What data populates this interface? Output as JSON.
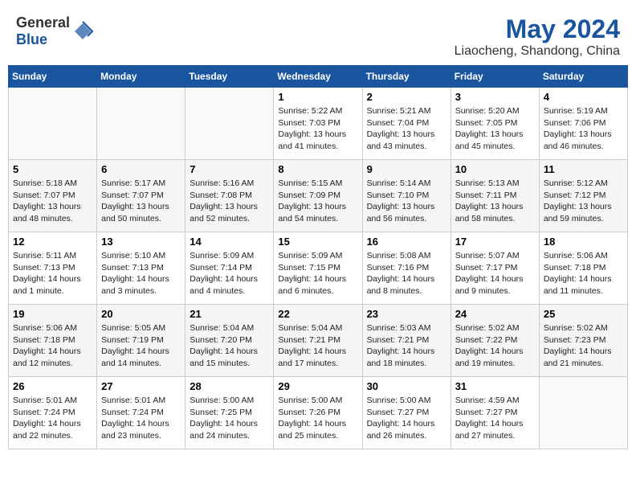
{
  "header": {
    "logo_general": "General",
    "logo_blue": "Blue",
    "month_year": "May 2024",
    "location": "Liaocheng, Shandong, China"
  },
  "weekdays": [
    "Sunday",
    "Monday",
    "Tuesday",
    "Wednesday",
    "Thursday",
    "Friday",
    "Saturday"
  ],
  "weeks": [
    [
      {
        "day": "",
        "info": ""
      },
      {
        "day": "",
        "info": ""
      },
      {
        "day": "",
        "info": ""
      },
      {
        "day": "1",
        "info": "Sunrise: 5:22 AM\nSunset: 7:03 PM\nDaylight: 13 hours\nand 41 minutes."
      },
      {
        "day": "2",
        "info": "Sunrise: 5:21 AM\nSunset: 7:04 PM\nDaylight: 13 hours\nand 43 minutes."
      },
      {
        "day": "3",
        "info": "Sunrise: 5:20 AM\nSunset: 7:05 PM\nDaylight: 13 hours\nand 45 minutes."
      },
      {
        "day": "4",
        "info": "Sunrise: 5:19 AM\nSunset: 7:06 PM\nDaylight: 13 hours\nand 46 minutes."
      }
    ],
    [
      {
        "day": "5",
        "info": "Sunrise: 5:18 AM\nSunset: 7:07 PM\nDaylight: 13 hours\nand 48 minutes."
      },
      {
        "day": "6",
        "info": "Sunrise: 5:17 AM\nSunset: 7:07 PM\nDaylight: 13 hours\nand 50 minutes."
      },
      {
        "day": "7",
        "info": "Sunrise: 5:16 AM\nSunset: 7:08 PM\nDaylight: 13 hours\nand 52 minutes."
      },
      {
        "day": "8",
        "info": "Sunrise: 5:15 AM\nSunset: 7:09 PM\nDaylight: 13 hours\nand 54 minutes."
      },
      {
        "day": "9",
        "info": "Sunrise: 5:14 AM\nSunset: 7:10 PM\nDaylight: 13 hours\nand 56 minutes."
      },
      {
        "day": "10",
        "info": "Sunrise: 5:13 AM\nSunset: 7:11 PM\nDaylight: 13 hours\nand 58 minutes."
      },
      {
        "day": "11",
        "info": "Sunrise: 5:12 AM\nSunset: 7:12 PM\nDaylight: 13 hours\nand 59 minutes."
      }
    ],
    [
      {
        "day": "12",
        "info": "Sunrise: 5:11 AM\nSunset: 7:13 PM\nDaylight: 14 hours\nand 1 minute."
      },
      {
        "day": "13",
        "info": "Sunrise: 5:10 AM\nSunset: 7:13 PM\nDaylight: 14 hours\nand 3 minutes."
      },
      {
        "day": "14",
        "info": "Sunrise: 5:09 AM\nSunset: 7:14 PM\nDaylight: 14 hours\nand 4 minutes."
      },
      {
        "day": "15",
        "info": "Sunrise: 5:09 AM\nSunset: 7:15 PM\nDaylight: 14 hours\nand 6 minutes."
      },
      {
        "day": "16",
        "info": "Sunrise: 5:08 AM\nSunset: 7:16 PM\nDaylight: 14 hours\nand 8 minutes."
      },
      {
        "day": "17",
        "info": "Sunrise: 5:07 AM\nSunset: 7:17 PM\nDaylight: 14 hours\nand 9 minutes."
      },
      {
        "day": "18",
        "info": "Sunrise: 5:06 AM\nSunset: 7:18 PM\nDaylight: 14 hours\nand 11 minutes."
      }
    ],
    [
      {
        "day": "19",
        "info": "Sunrise: 5:06 AM\nSunset: 7:18 PM\nDaylight: 14 hours\nand 12 minutes."
      },
      {
        "day": "20",
        "info": "Sunrise: 5:05 AM\nSunset: 7:19 PM\nDaylight: 14 hours\nand 14 minutes."
      },
      {
        "day": "21",
        "info": "Sunrise: 5:04 AM\nSunset: 7:20 PM\nDaylight: 14 hours\nand 15 minutes."
      },
      {
        "day": "22",
        "info": "Sunrise: 5:04 AM\nSunset: 7:21 PM\nDaylight: 14 hours\nand 17 minutes."
      },
      {
        "day": "23",
        "info": "Sunrise: 5:03 AM\nSunset: 7:21 PM\nDaylight: 14 hours\nand 18 minutes."
      },
      {
        "day": "24",
        "info": "Sunrise: 5:02 AM\nSunset: 7:22 PM\nDaylight: 14 hours\nand 19 minutes."
      },
      {
        "day": "25",
        "info": "Sunrise: 5:02 AM\nSunset: 7:23 PM\nDaylight: 14 hours\nand 21 minutes."
      }
    ],
    [
      {
        "day": "26",
        "info": "Sunrise: 5:01 AM\nSunset: 7:24 PM\nDaylight: 14 hours\nand 22 minutes."
      },
      {
        "day": "27",
        "info": "Sunrise: 5:01 AM\nSunset: 7:24 PM\nDaylight: 14 hours\nand 23 minutes."
      },
      {
        "day": "28",
        "info": "Sunrise: 5:00 AM\nSunset: 7:25 PM\nDaylight: 14 hours\nand 24 minutes."
      },
      {
        "day": "29",
        "info": "Sunrise: 5:00 AM\nSunset: 7:26 PM\nDaylight: 14 hours\nand 25 minutes."
      },
      {
        "day": "30",
        "info": "Sunrise: 5:00 AM\nSunset: 7:27 PM\nDaylight: 14 hours\nand 26 minutes."
      },
      {
        "day": "31",
        "info": "Sunrise: 4:59 AM\nSunset: 7:27 PM\nDaylight: 14 hours\nand 27 minutes."
      },
      {
        "day": "",
        "info": ""
      }
    ]
  ]
}
